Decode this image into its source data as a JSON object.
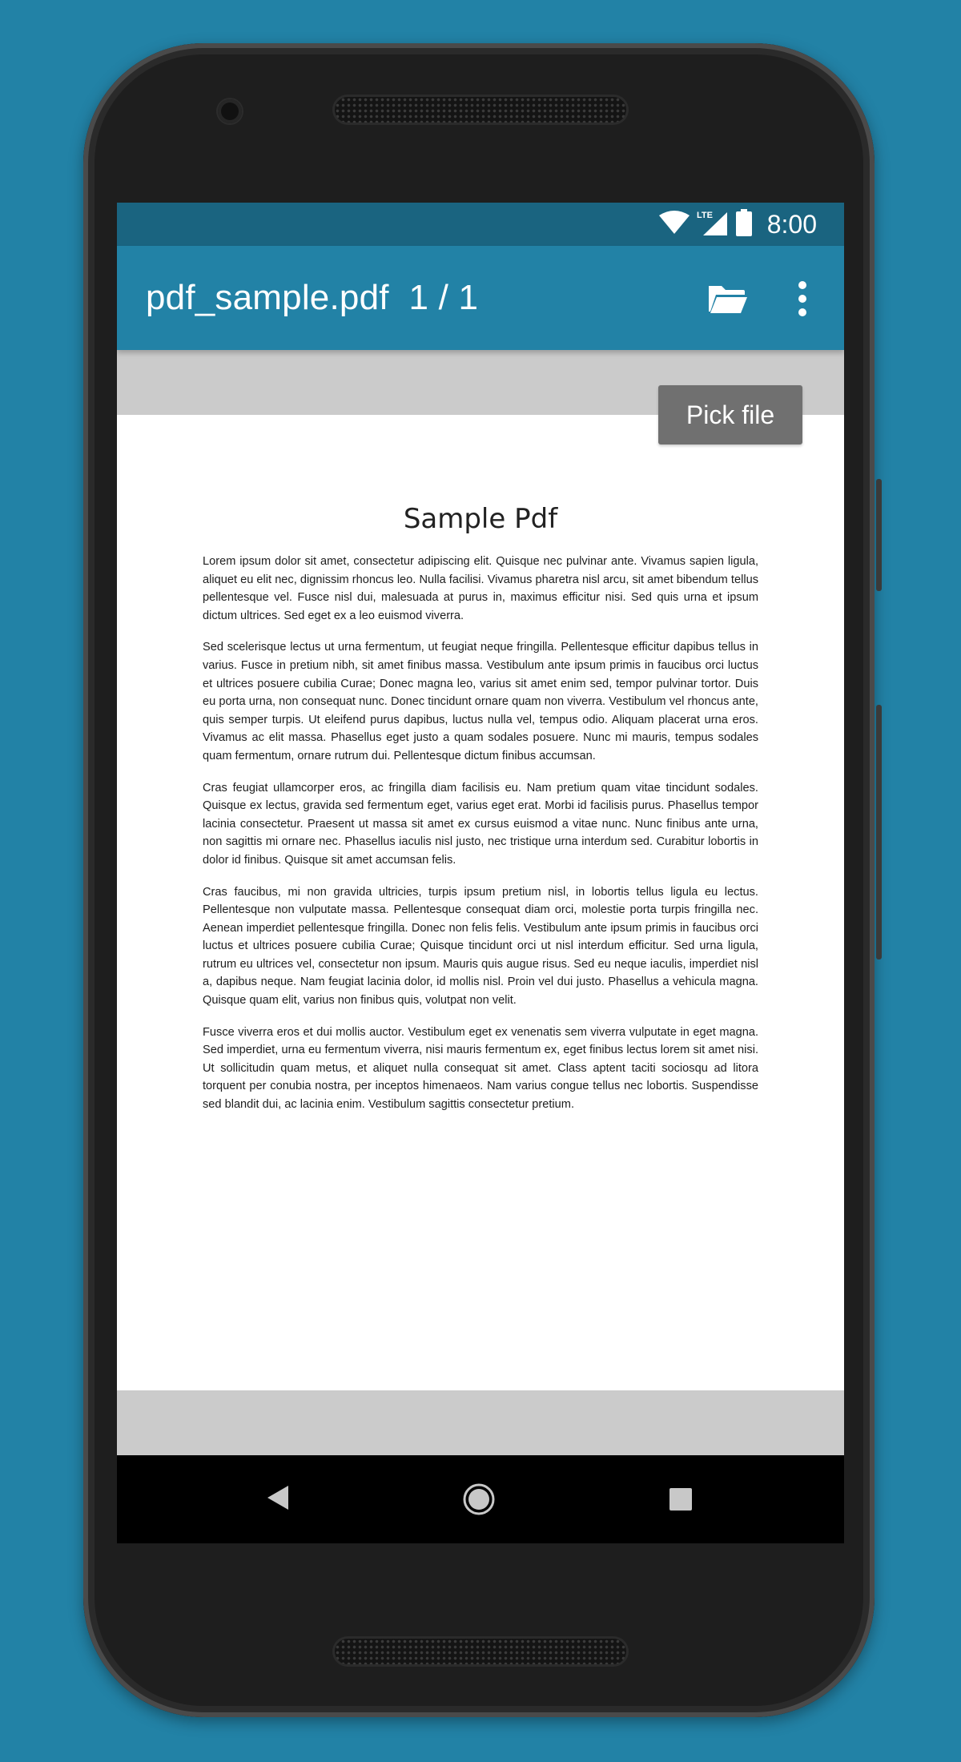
{
  "colors": {
    "background": "#2282a6",
    "status_bar": "#1a6480",
    "app_bar": "#2282a6",
    "viewer_background": "#cbcbcb",
    "pick_file_button": "#707070"
  },
  "status_bar": {
    "time": "8:00",
    "network_label": "LTE",
    "icons": [
      "wifi-icon",
      "lte-signal-icon",
      "battery-icon"
    ]
  },
  "app_bar": {
    "title": "pdf_sample.pdf  1 / 1",
    "actions": [
      "folder-open-icon",
      "more-vert-icon"
    ]
  },
  "viewer": {
    "pick_file_label": "Pick file",
    "document": {
      "title": "Sample Pdf",
      "paragraphs": [
        "Lorem ipsum dolor sit amet, consectetur adipiscing elit. Quisque nec pulvinar ante. Vivamus sapien ligula, aliquet eu elit nec, dignissim rhoncus leo. Nulla facilisi. Vivamus pharetra nisl arcu, sit amet bibendum tellus pellentesque vel. Fusce nisl dui, malesuada at purus in, maximus efficitur nisi. Sed quis urna et ipsum dictum ultrices. Sed eget ex a leo euismod viverra.",
        "Sed scelerisque lectus ut urna fermentum, ut feugiat neque fringilla. Pellentesque efficitur dapibus tellus in varius. Fusce in pretium nibh, sit amet finibus massa. Vestibulum ante ipsum primis in faucibus orci luctus et ultrices posuere cubilia Curae; Donec magna leo, varius sit amet enim sed, tempor pulvinar tortor. Duis eu porta urna, non consequat nunc. Donec tincidunt ornare quam non viverra. Vestibulum vel rhoncus ante, quis semper turpis. Ut eleifend purus dapibus, luctus nulla vel, tempus odio. Aliquam placerat urna eros. Vivamus ac elit massa. Phasellus eget justo a quam sodales posuere. Nunc mi mauris, tempus sodales quam fermentum, ornare rutrum dui. Pellentesque dictum finibus accumsan.",
        "Cras feugiat ullamcorper eros, ac fringilla diam facilisis eu. Nam pretium quam vitae tincidunt sodales. Quisque ex lectus, gravida sed fermentum eget, varius eget erat. Morbi id facilisis purus. Phasellus tempor lacinia consectetur. Praesent ut massa sit amet ex cursus euismod a vitae nunc. Nunc finibus ante urna, non sagittis mi ornare nec. Phasellus iaculis nisl justo, nec tristique urna interdum sed. Curabitur lobortis in dolor id finibus. Quisque sit amet accumsan felis.",
        "Cras faucibus, mi non gravida ultricies, turpis ipsum pretium nisl, in lobortis tellus ligula eu lectus. Pellentesque non vulputate massa. Pellentesque consequat diam orci, molestie porta turpis fringilla nec. Aenean imperdiet pellentesque fringilla. Donec non felis felis. Vestibulum ante ipsum primis in faucibus orci luctus et ultrices posuere cubilia Curae; Quisque tincidunt orci ut nisl interdum efficitur. Sed urna ligula, rutrum eu ultrices vel, consectetur non ipsum. Mauris quis augue risus. Sed eu neque iaculis, imperdiet nisl a, dapibus neque. Nam feugiat lacinia dolor, id mollis nisl. Proin vel dui justo. Phasellus a vehicula magna. Quisque quam elit, varius non finibus quis, volutpat non velit.",
        "Fusce viverra eros et dui mollis auctor. Vestibulum eget ex venenatis sem viverra vulputate in eget magna. Sed imperdiet, urna eu fermentum viverra, nisi mauris fermentum ex, eget finibus lectus lorem sit amet nisi. Ut sollicitudin quam metus, et aliquet nulla consequat sit amet. Class aptent taciti sociosqu ad litora torquent per conubia nostra, per inceptos himenaeos. Nam varius congue tellus nec lobortis. Suspendisse sed blandit dui, ac lacinia enim. Vestibulum sagittis consectetur pretium."
      ]
    }
  },
  "navigation_bar": {
    "buttons": [
      "back-icon",
      "home-icon",
      "recents-icon"
    ]
  }
}
